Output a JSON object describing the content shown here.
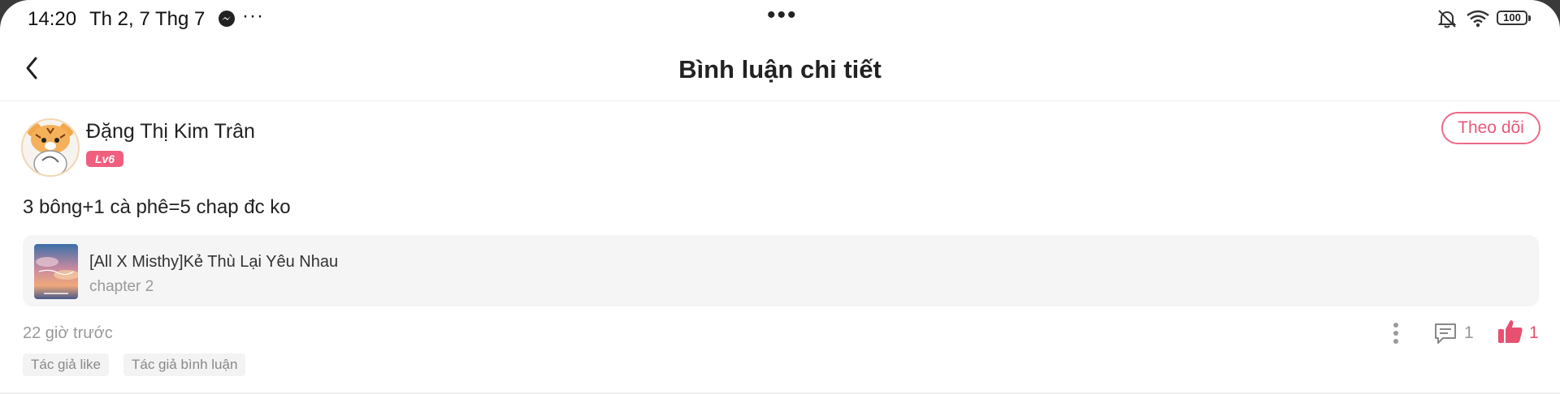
{
  "status_bar": {
    "time": "14:20",
    "date": "Th 2, 7 Thg 7",
    "more": "···",
    "center_dots": "•••",
    "battery": "100",
    "icons": [
      "messenger-icon",
      "bell-off-icon",
      "wifi-icon",
      "battery-icon"
    ]
  },
  "header": {
    "title": "Bình luận chi tiết",
    "back_icon": "chevron-left-icon"
  },
  "comment": {
    "author": "Đặng Thị Kim Trân",
    "level": "Lv6",
    "follow_label": "Theo dõi",
    "text": "3 bông+1 cà phê=5 chap đc ko",
    "story": {
      "title": "[All X Misthy]Kẻ Thù Lại Yêu Nhau",
      "chapter": "chapter 2"
    },
    "time_ago": "22 giờ trước",
    "reply_count": "1",
    "like_count": "1",
    "tags": [
      "Tác giả like",
      "Tác giả bình luận"
    ]
  },
  "colors": {
    "accent": "#e85a7a",
    "badge": "#f0607e",
    "muted": "#999999",
    "card_bg": "#f5f5f5"
  }
}
